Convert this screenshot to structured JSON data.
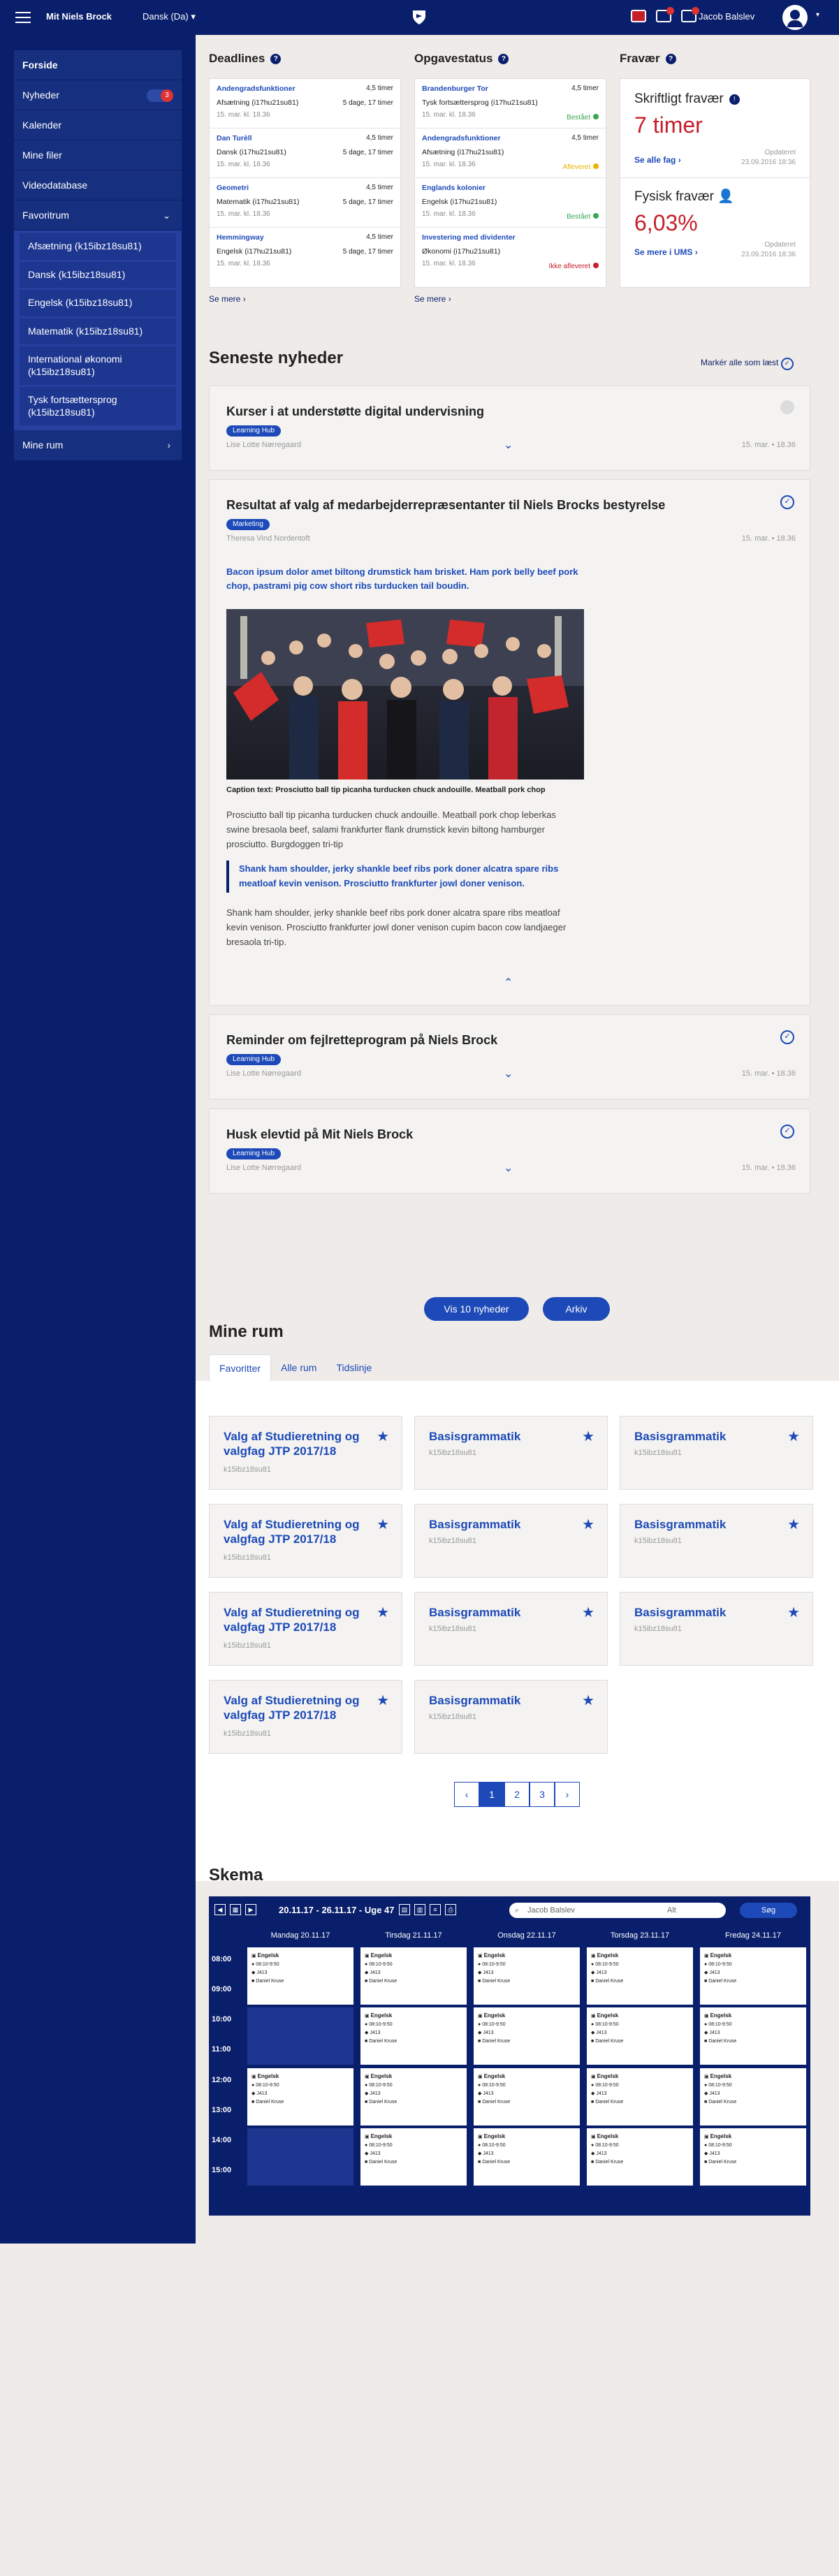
{
  "topbar": {
    "brand": "Mit Niels Brock",
    "language": "Dansk (Da)",
    "user": "Jacob Balslev",
    "badges": [
      "5",
      "2"
    ]
  },
  "sidebar": {
    "items": [
      {
        "label": "Forside"
      },
      {
        "label": "Nyheder",
        "badge": "3"
      },
      {
        "label": "Kalender"
      },
      {
        "label": "Mine filer"
      },
      {
        "label": "Videodatabase"
      },
      {
        "label": "Favoritrum"
      }
    ],
    "favorites": [
      "Afsætning (k15ibz18su81)",
      "Dansk (k15ibz18su81)",
      "Engelsk (k15ibz18su81)",
      "Matematik (k15ibz18su81)",
      "International økonomi (k15ibz18su81)",
      "Tysk fortsættersprog (k15ibz18su81)"
    ],
    "last": "Mine rum"
  },
  "deadlines": {
    "title": "Deadlines",
    "see_more": "Se mere",
    "items": [
      {
        "title": "Andengradsfunktioner",
        "course": "Afsætning (i17hu21su81)",
        "date": "15. mar. kl. 18.36",
        "hours": "4,5 timer",
        "days": "5 dage, 17 timer"
      },
      {
        "title": "Dan Turèll",
        "course": "Dansk (i17hu21su81)",
        "date": "15. mar. kl. 18.36",
        "hours": "4,5 timer",
        "days": "5 dage, 17 timer"
      },
      {
        "title": "Geometri",
        "course": "Matematik (i17hu21su81)",
        "date": "15. mar. kl. 18.36",
        "hours": "4,5 timer",
        "days": "5 dage, 17 timer"
      },
      {
        "title": "Hemmingway",
        "course": "Engelsk (i17hu21su81)",
        "date": "15. mar. kl. 18.36",
        "hours": "4,5 timer",
        "days": "5 dage, 17 timer"
      }
    ]
  },
  "opgavestatus": {
    "title": "Opgavestatus",
    "see_more": "Se mere",
    "items": [
      {
        "title": "Brandenburger Tor",
        "course": "Tysk fortsættersprog (i17hu21su81)",
        "date": "15. mar. kl. 18.36",
        "hours": "4,5 timer",
        "status": "Bestået",
        "color": "#3aa655"
      },
      {
        "title": "Andengradsfunktioner",
        "course": "Afsætning (i17hu21su81)",
        "date": "15. mar. kl. 18.36",
        "hours": "4,5 timer",
        "status": "Afleveret",
        "color": "#e8b400"
      },
      {
        "title": "Englands kolonier",
        "course": "Engelsk (i17hu21su81)",
        "date": "15. mar. kl. 18.36",
        "hours": "",
        "status": "Bestået",
        "color": "#3aa655"
      },
      {
        "title": "Investering med dividenter",
        "course": "Økonomi (i17hu21su81)",
        "date": "15. mar. kl. 18.36",
        "hours": "",
        "status": "Ikke afleveret",
        "color": "#c5202a"
      }
    ]
  },
  "fravaer": {
    "title": "Fravær",
    "written_label": "Skriftligt fravær",
    "written_value": "7 timer",
    "written_link": "Se alle fag",
    "updated_label": "Opdateret",
    "updated_date": "23.09.2016 18:36",
    "physical_label": "Fysisk fravær",
    "physical_value": "6,03%",
    "physical_link": "Se mere i UMS"
  },
  "news": {
    "title": "Seneste nyheder",
    "mark_all": "Markér alle som læst",
    "items": [
      {
        "title": "Kurser i at understøtte digital undervisning",
        "tag": "Learning Hub",
        "author": "Lise Lotte Nørregaard",
        "date": "15. mar. • 18.36"
      },
      {
        "title": "Resultat af valg af medarbejderrepræsentanter til Niels Brocks bestyrelse",
        "tag": "Marketing",
        "author": "Theresa Vind Nordentoft",
        "date": "15. mar. • 18.36",
        "lead": "Bacon ipsum dolor amet biltong drumstick ham brisket. Ham pork belly beef pork chop, pastrami pig cow short ribs turducken tail boudin.",
        "caption": "Caption text: Prosciutto ball tip picanha turducken chuck andouille. Meatball pork chop",
        "body1": "Prosciutto ball tip picanha turducken chuck andouille. Meatball pork chop leberkas swine bresaola beef, salami frankfurter flank drumstick kevin biltong hamburger prosciutto. Burgdoggen tri-tip",
        "quote": "Shank ham shoulder, jerky shankle beef ribs pork doner alcatra spare ribs meatloaf kevin venison. Prosciutto frankfurter jowl doner venison.",
        "body2": "Shank ham shoulder, jerky shankle beef ribs pork doner alcatra spare ribs meatloaf kevin venison. Prosciutto frankfurter jowl doner venison cupim bacon cow landjaeger bresaola tri-tip."
      },
      {
        "title": "Reminder om fejlretteprogram på Niels Brock",
        "tag": "Learning Hub",
        "author": "Lise Lotte Nørregaard",
        "date": "15. mar. • 18.36"
      },
      {
        "title": "Husk elevtid på Mit Niels Brock",
        "tag": "Learning Hub",
        "author": "Lise Lotte Nørregaard",
        "date": "15. mar. • 18.36"
      }
    ],
    "more_button": "Vis 10 nyheder",
    "archive_button": "Arkiv"
  },
  "rooms": {
    "title": "Mine rum",
    "tabs": [
      "Favoritter",
      "Alle rum",
      "Tidslinje"
    ],
    "items": [
      {
        "name": "Valg af Studieretning og valgfag JTP 2017/18",
        "code": "k15ibz18su81"
      },
      {
        "name": "Basisgrammatik",
        "code": "k15ibz18su81"
      },
      {
        "name": "Basisgrammatik",
        "code": "k15ibz18su81"
      },
      {
        "name": "Valg af Studieretning og valgfag JTP 2017/18",
        "code": "k15ibz18su81"
      },
      {
        "name": "Basisgrammatik",
        "code": "k15ibz18su81"
      },
      {
        "name": "Basisgrammatik",
        "code": "k15ibz18su81"
      },
      {
        "name": "Valg af Studieretning og valgfag JTP 2017/18",
        "code": "k15ibz18su81"
      },
      {
        "name": "Basisgrammatik",
        "code": "k15ibz18su81"
      },
      {
        "name": "Basisgrammatik",
        "code": "k15ibz18su81"
      },
      {
        "name": "Valg af Studieretning og valgfag JTP 2017/18",
        "code": "k15ibz18su81"
      },
      {
        "name": "Basisgrammatik",
        "code": "k15ibz18su81"
      }
    ],
    "pages": [
      "‹",
      "1",
      "2",
      "3",
      "›"
    ]
  },
  "schedule": {
    "title": "Skema",
    "week": "20.11.17 - 26.11.17 - Uge 47",
    "search": "Jacob Balslev",
    "filter": "Alt",
    "search_button": "Søg",
    "days": [
      "Mandag 20.11.17",
      "Tirsdag 21.11.17",
      "Onsdag 22.11.17",
      "Torsdag 23.11.17",
      "Fredag 24.11.17"
    ],
    "times": [
      "08:00",
      "09:00",
      "10:00",
      "11:00",
      "12:00",
      "13:00",
      "14:00",
      "15:00"
    ],
    "lesson": {
      "name": "Engelsk",
      "time": "08:10-9:50",
      "room": "J413",
      "teacher": "Daniel Kruse"
    }
  }
}
